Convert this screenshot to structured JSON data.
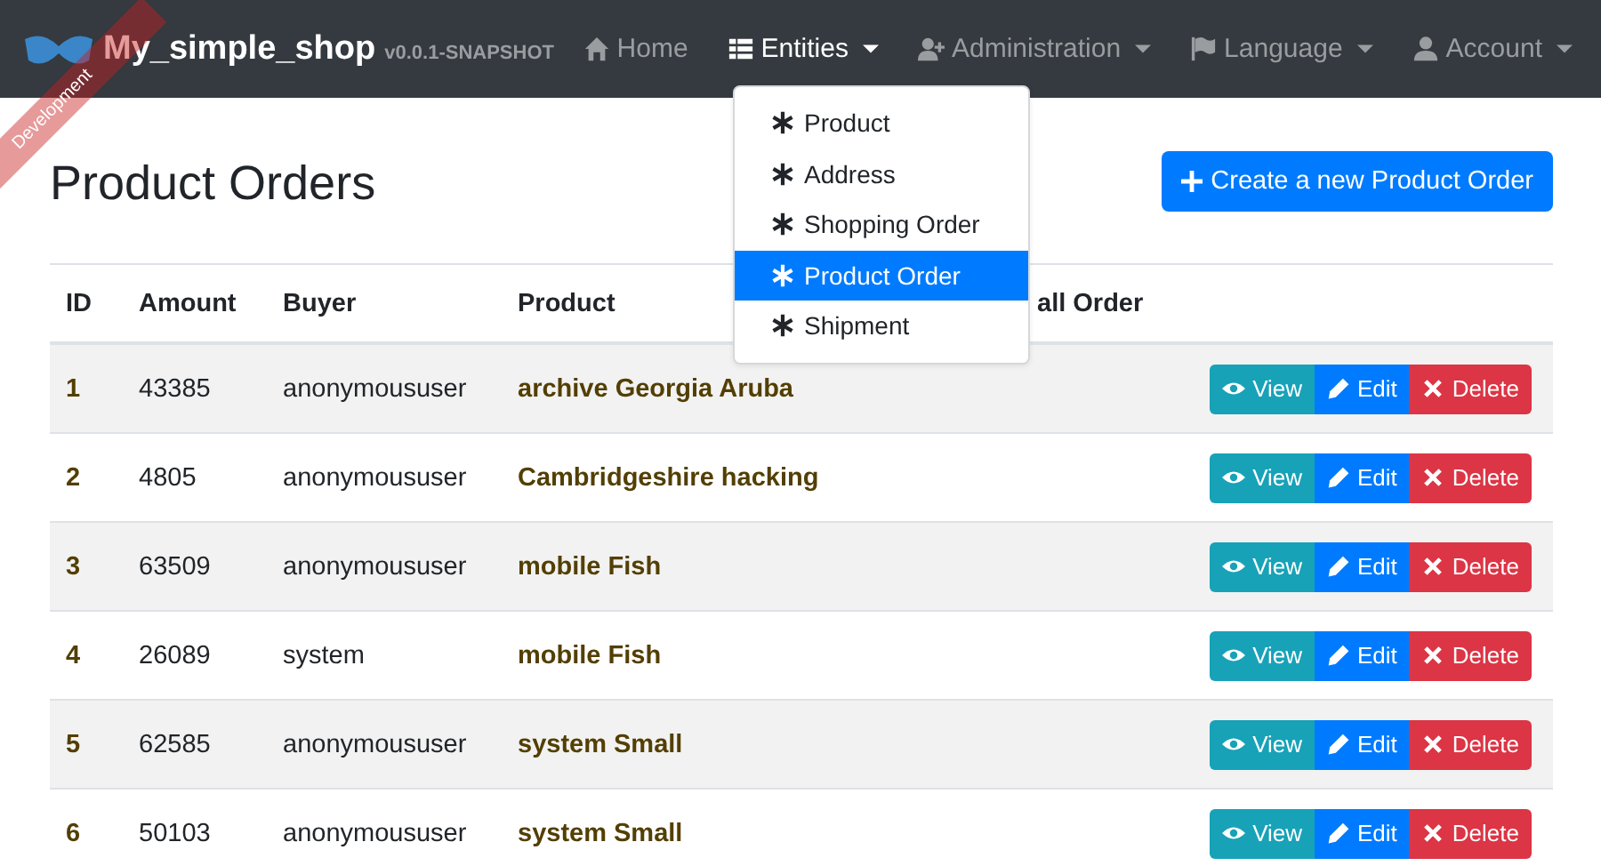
{
  "navbar": {
    "brand": "My_simple_shop",
    "version": "v0.0.1-SNAPSHOT",
    "items": [
      {
        "kind": "home",
        "label": "Home",
        "selected": false,
        "dropdown": false
      },
      {
        "kind": "list",
        "label": "Entities",
        "selected": true,
        "dropdown": true
      },
      {
        "kind": "user-plus",
        "label": "Administration",
        "selected": false,
        "dropdown": true
      },
      {
        "kind": "flag",
        "label": "Language",
        "selected": false,
        "dropdown": true
      },
      {
        "kind": "user",
        "label": "Account",
        "selected": false,
        "dropdown": true
      }
    ]
  },
  "ribbon": "Development",
  "entities_menu": [
    {
      "label": "Product",
      "selected": false
    },
    {
      "label": "Address",
      "selected": false
    },
    {
      "label": "Shopping Order",
      "selected": false
    },
    {
      "label": "Product Order",
      "selected": true
    },
    {
      "label": "Shipment",
      "selected": false
    }
  ],
  "page": {
    "title": "Product Orders",
    "create_button": "Create a new Product Order"
  },
  "table": {
    "columns": [
      "ID",
      "Amount",
      "Buyer",
      "Product",
      "all Order"
    ],
    "rows": [
      {
        "id": "1",
        "amount": "43385",
        "buyer": "anonymoususer",
        "product": "archive Georgia Aruba",
        "actions": [
          "View",
          "Edit",
          "Delete"
        ]
      },
      {
        "id": "2",
        "amount": "4805",
        "buyer": "anonymoususer",
        "product": "Cambridgeshire hacking",
        "actions": [
          "View",
          "Edit",
          "Delete"
        ]
      },
      {
        "id": "3",
        "amount": "63509",
        "buyer": "anonymoususer",
        "product": "mobile Fish",
        "actions": [
          "View",
          "Edit",
          "Delete"
        ]
      },
      {
        "id": "4",
        "amount": "26089",
        "buyer": "system",
        "product": "mobile Fish",
        "actions": [
          "View",
          "Edit",
          "Delete"
        ]
      },
      {
        "id": "5",
        "amount": "62585",
        "buyer": "anonymoususer",
        "product": "system Small",
        "actions": [
          "View",
          "Edit",
          "Delete"
        ]
      },
      {
        "id": "6",
        "amount": "50103",
        "buyer": "anonymoususer",
        "product": "system Small",
        "actions": [
          "View",
          "Edit",
          "Delete"
        ]
      }
    ]
  }
}
